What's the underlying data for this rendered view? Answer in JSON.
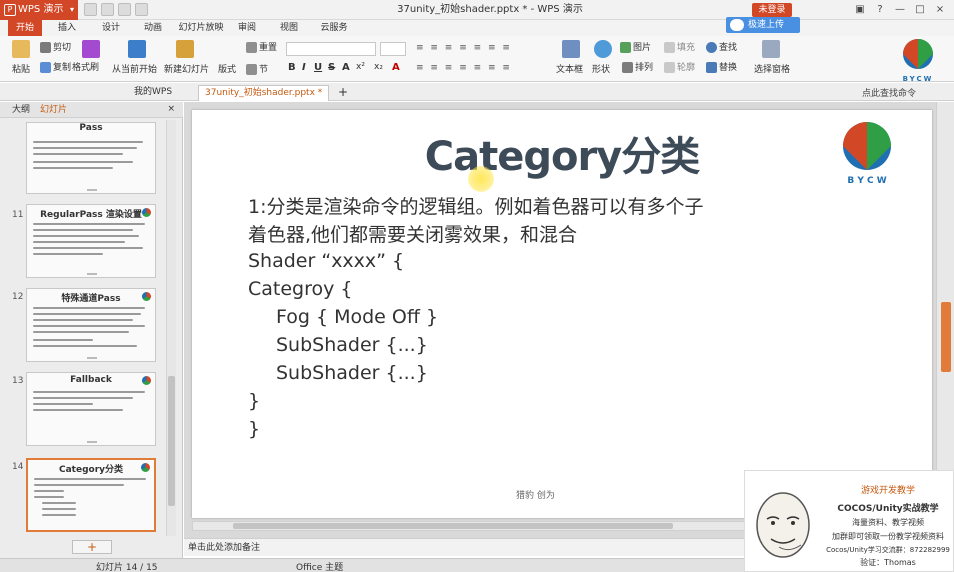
{
  "titlebar": {
    "app_name": "WPS 演示",
    "doc_title": "37unity_初始shader.pptx * - WPS 演示",
    "login": "未登录",
    "min": "—",
    "max": "□",
    "close": "×"
  },
  "ribbon_tabs": [
    "开始",
    "插入",
    "设计",
    "动画",
    "幻灯片放映",
    "审阅",
    "视图",
    "云服务"
  ],
  "upload_label": "极速上传",
  "ribbon": {
    "paste": "粘贴",
    "cut": "剪切",
    "copy": "复制",
    "format_painter": "格式刷",
    "from_current": "从当前开始",
    "new_slide": "新建幻灯片",
    "layout": "版式",
    "section": "节",
    "reset": "重置",
    "textbox": "文本框",
    "shape": "形状",
    "arrange": "排列",
    "picture": "图片",
    "fill": "填充",
    "outline": "轮廓",
    "find": "查找",
    "replace": "替换",
    "select_pane": "选择窗格",
    "format_glyphs": [
      "B",
      "I",
      "U",
      "S",
      "A",
      "x²",
      "x₂",
      "A"
    ]
  },
  "logo": {
    "text": "BYCW",
    "colors": [
      "#d24726",
      "#2f9e44",
      "#1f6fb2"
    ]
  },
  "doc_tabs": {
    "home": "我的WPS",
    "current": "37unity_初始shader.pptx *",
    "add": "+"
  },
  "search_command": "点此查找命令",
  "left_panel": {
    "tab_outline": "大纲",
    "tab_slides": "幻灯片",
    "close": "×",
    "add_button": "+",
    "thumbnails": [
      {
        "num": "",
        "title": "Pass"
      },
      {
        "num": "11",
        "title": "RegularPass 渲染设置"
      },
      {
        "num": "12",
        "title": "特殊通道Pass"
      },
      {
        "num": "13",
        "title": "Fallback"
      },
      {
        "num": "14",
        "title": "Category分类"
      }
    ]
  },
  "slide": {
    "title": "Category分类",
    "logo_text": "B Y C W",
    "lines": [
      "1:分类是渲染命令的逻辑组。例如着色器可以有多个子",
      "着色器,他们都需要关闭雾效果，和混合",
      "Shader “xxxx” {",
      "Categroy {",
      "Fog { Mode Off }",
      "SubShader {...}",
      "SubShader {...}",
      "}",
      "}"
    ],
    "footer": "猎豹 创为"
  },
  "notes_placeholder": "单击此处添加备注",
  "status": {
    "slide_index": "幻灯片 14 / 15",
    "theme": "Office 主题"
  },
  "overlay": {
    "line1": "游戏开发教学",
    "line2": "COCOS/Unity实战教学",
    "line3": "海量资料、教学视频",
    "line4": "加群即可领取一份教学视频资料",
    "line5": "Cocos/Unity学习交流群：872282999",
    "line6": "验证：Thomas"
  }
}
